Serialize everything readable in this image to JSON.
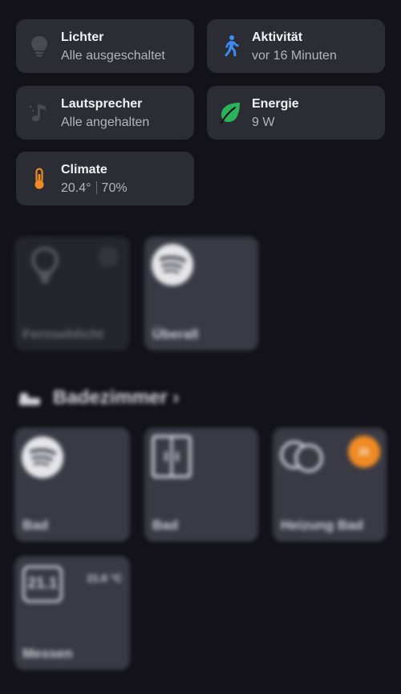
{
  "summary": {
    "lights": {
      "title": "Lichter",
      "subtitle": "Alle ausgeschaltet",
      "icon": "lightbulb-icon"
    },
    "activity": {
      "title": "Aktivität",
      "subtitle": "vor 16 Minuten",
      "icon": "walking-person-icon"
    },
    "speakers": {
      "title": "Lautsprecher",
      "subtitle": "Alle angehalten",
      "icon": "music-note-icon"
    },
    "energy": {
      "title": "Energie",
      "subtitle": "9 W",
      "icon": "leaf-icon"
    },
    "climate": {
      "title": "Climate",
      "temperature": "20.4°",
      "humidity": "70%",
      "icon": "thermometer-icon"
    }
  },
  "favorites": [
    {
      "label": "Fernsehlicht",
      "icon": "lightbulb-icon",
      "state": "off"
    },
    {
      "label": "Überall",
      "icon": "spotify-icon"
    }
  ],
  "room": {
    "name": "Badezimmer",
    "tiles": [
      {
        "label": "Bad",
        "icon": "spotify-icon"
      },
      {
        "label": "Bad",
        "icon": "cover-icon"
      },
      {
        "label": "Heizung Bad",
        "icon": "toggle-icon",
        "badge": "21"
      },
      {
        "label": "Messen",
        "icon": "display-icon",
        "display_value": "21.1",
        "reading": "21.6 °C"
      }
    ]
  },
  "colors": {
    "background": "#121218",
    "card": "#2c2c34",
    "activity_blue": "#3b8df2",
    "energy_green": "#2bb45a",
    "climate_orange": "#f08a24"
  }
}
